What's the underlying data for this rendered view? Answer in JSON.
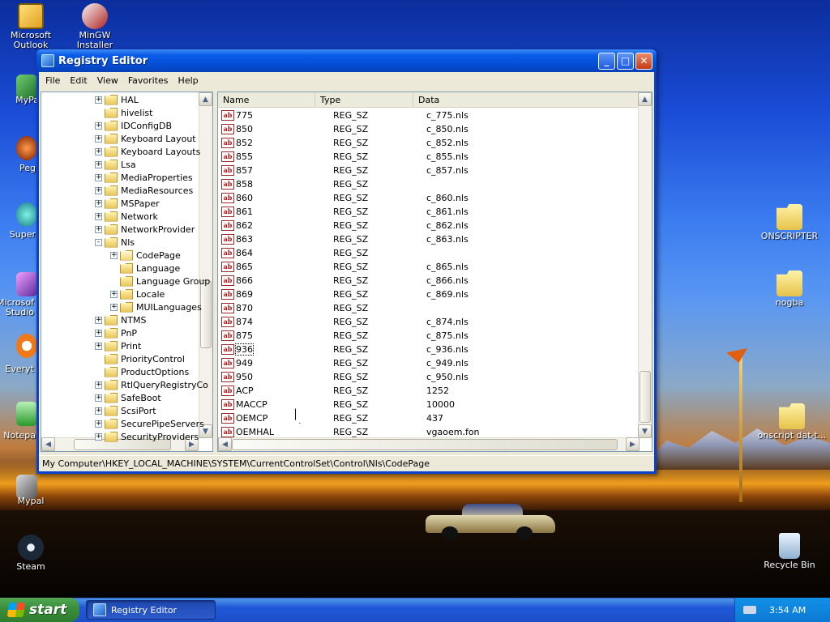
{
  "desktop": {
    "icons": [
      {
        "label": "Microsoft Outlook",
        "name": "outlook-icon"
      },
      {
        "label": "MinGW Installer",
        "name": "mingw-icon"
      },
      {
        "label": "MyPa",
        "name": "mypaint-icon"
      },
      {
        "label": "Peg",
        "name": "pegasus-icon"
      },
      {
        "label": "Super",
        "name": "super-icon"
      },
      {
        "label": "Microsof Studio",
        "name": "studio-icon"
      },
      {
        "label": "Everyt",
        "name": "everything-icon"
      },
      {
        "label": "Notepa",
        "name": "notepad-icon"
      },
      {
        "label": "Mypal",
        "name": "mypal-icon"
      },
      {
        "label": "Steam",
        "name": "steam-icon"
      },
      {
        "label": "ONSCRIPTER",
        "name": "onscripter-folder-icon"
      },
      {
        "label": "nogba",
        "name": "nogba-folder-icon"
      },
      {
        "label": "onscript dat-t...",
        "name": "onscript-folder-icon"
      },
      {
        "label": "Recycle Bin",
        "name": "recycle-bin-icon"
      }
    ]
  },
  "window": {
    "title": "Registry Editor",
    "controls": {
      "minimize": "_",
      "maximize": "□",
      "close": "✕"
    },
    "menu": [
      "File",
      "Edit",
      "View",
      "Favorites",
      "Help"
    ],
    "tree": [
      {
        "label": "HAL",
        "exp": "+",
        "indent": 0
      },
      {
        "label": "hivelist",
        "exp": "",
        "indent": 0
      },
      {
        "label": "IDConfigDB",
        "exp": "+",
        "indent": 0
      },
      {
        "label": "Keyboard Layout",
        "exp": "+",
        "indent": 0
      },
      {
        "label": "Keyboard Layouts",
        "exp": "+",
        "indent": 0
      },
      {
        "label": "Lsa",
        "exp": "+",
        "indent": 0
      },
      {
        "label": "MediaProperties",
        "exp": "+",
        "indent": 0
      },
      {
        "label": "MediaResources",
        "exp": "+",
        "indent": 0
      },
      {
        "label": "MSPaper",
        "exp": "+",
        "indent": 0
      },
      {
        "label": "Network",
        "exp": "+",
        "indent": 0
      },
      {
        "label": "NetworkProvider",
        "exp": "+",
        "indent": 0
      },
      {
        "label": "Nls",
        "exp": "-",
        "indent": 0
      },
      {
        "label": "CodePage",
        "exp": "+",
        "indent": 1,
        "open": true
      },
      {
        "label": "Language",
        "exp": "",
        "indent": 1
      },
      {
        "label": "Language Group",
        "exp": "",
        "indent": 1
      },
      {
        "label": "Locale",
        "exp": "+",
        "indent": 1
      },
      {
        "label": "MUILanguages",
        "exp": "+",
        "indent": 1
      },
      {
        "label": "NTMS",
        "exp": "+",
        "indent": 0
      },
      {
        "label": "PnP",
        "exp": "+",
        "indent": 0
      },
      {
        "label": "Print",
        "exp": "+",
        "indent": 0
      },
      {
        "label": "PriorityControl",
        "exp": "",
        "indent": 0
      },
      {
        "label": "ProductOptions",
        "exp": "",
        "indent": 0
      },
      {
        "label": "RtlQueryRegistryCo",
        "exp": "+",
        "indent": 0
      },
      {
        "label": "SafeBoot",
        "exp": "+",
        "indent": 0
      },
      {
        "label": "ScsiPort",
        "exp": "+",
        "indent": 0
      },
      {
        "label": "SecurePipeServers",
        "exp": "+",
        "indent": 0
      },
      {
        "label": "SecurityProviders",
        "exp": "+",
        "indent": 0
      }
    ],
    "columns": [
      "Name",
      "Type",
      "Data"
    ],
    "values": [
      {
        "name": "775",
        "type": "REG_SZ",
        "data": "c_775.nls"
      },
      {
        "name": "850",
        "type": "REG_SZ",
        "data": "c_850.nls"
      },
      {
        "name": "852",
        "type": "REG_SZ",
        "data": "c_852.nls"
      },
      {
        "name": "855",
        "type": "REG_SZ",
        "data": "c_855.nls"
      },
      {
        "name": "857",
        "type": "REG_SZ",
        "data": "c_857.nls"
      },
      {
        "name": "858",
        "type": "REG_SZ",
        "data": ""
      },
      {
        "name": "860",
        "type": "REG_SZ",
        "data": "c_860.nls"
      },
      {
        "name": "861",
        "type": "REG_SZ",
        "data": "c_861.nls"
      },
      {
        "name": "862",
        "type": "REG_SZ",
        "data": "c_862.nls"
      },
      {
        "name": "863",
        "type": "REG_SZ",
        "data": "c_863.nls"
      },
      {
        "name": "864",
        "type": "REG_SZ",
        "data": ""
      },
      {
        "name": "865",
        "type": "REG_SZ",
        "data": "c_865.nls"
      },
      {
        "name": "866",
        "type": "REG_SZ",
        "data": "c_866.nls"
      },
      {
        "name": "869",
        "type": "REG_SZ",
        "data": "c_869.nls"
      },
      {
        "name": "870",
        "type": "REG_SZ",
        "data": ""
      },
      {
        "name": "874",
        "type": "REG_SZ",
        "data": "c_874.nls"
      },
      {
        "name": "875",
        "type": "REG_SZ",
        "data": "c_875.nls"
      },
      {
        "name": "936",
        "type": "REG_SZ",
        "data": "c_936.nls",
        "focused": true
      },
      {
        "name": "949",
        "type": "REG_SZ",
        "data": "c_949.nls"
      },
      {
        "name": "950",
        "type": "REG_SZ",
        "data": "c_950.nls"
      },
      {
        "name": "ACP",
        "type": "REG_SZ",
        "data": "1252"
      },
      {
        "name": "MACCP",
        "type": "REG_SZ",
        "data": "10000"
      },
      {
        "name": "OEMCP",
        "type": "REG_SZ",
        "data": "437"
      },
      {
        "name": "OEMHAL",
        "type": "REG_SZ",
        "data": "vgaoem.fon"
      }
    ],
    "value_icon_text": "ab",
    "status_path": "My Computer\\HKEY_LOCAL_MACHINE\\SYSTEM\\CurrentControlSet\\Control\\Nls\\CodePage"
  },
  "taskbar": {
    "start_label": "start",
    "task_label": "Registry Editor",
    "clock": "3:54 AM"
  },
  "colors": {
    "titlebar": "#0a5ce8",
    "start": "#3c8f3c",
    "value_icon": "#b01010"
  }
}
